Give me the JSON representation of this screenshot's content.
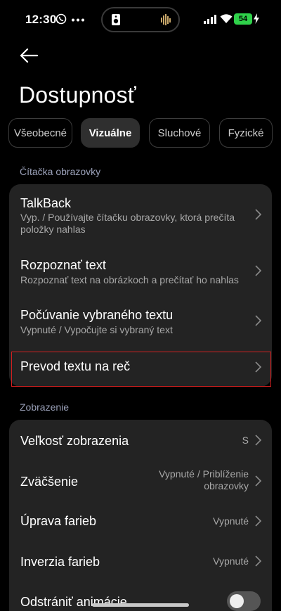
{
  "status": {
    "time": "12:30",
    "battery": "54"
  },
  "header": {
    "title": "Dostupnosť"
  },
  "tabs": [
    {
      "label": "Všeobecné"
    },
    {
      "label": "Vizuálne"
    },
    {
      "label": "Sluchové"
    },
    {
      "label": "Fyzické"
    }
  ],
  "sections": {
    "reader": {
      "label": "Čítačka obrazovky",
      "items": [
        {
          "title": "TalkBack",
          "subtitle": "Vyp. / Používajte čítačku obrazovky, ktorá prečíta položky nahlas"
        },
        {
          "title": "Rozpoznať text",
          "subtitle": "Rozpoznať text na obrázkoch a prečítať ho nahlas"
        },
        {
          "title": "Počúvanie vybraného textu",
          "subtitle": "Vypnuté / Vypočujte si vybraný text"
        },
        {
          "title": "Prevod textu na reč"
        }
      ]
    },
    "display": {
      "label": "Zobrazenie",
      "items": [
        {
          "title": "Veľkosť zobrazenia",
          "value": "S"
        },
        {
          "title": "Zväčšenie",
          "value": "Vypnuté / Priblíženie obrazovky"
        },
        {
          "title": "Úprava farieb",
          "value": "Vypnuté"
        },
        {
          "title": "Inverzia farieb",
          "value": "Vypnuté"
        },
        {
          "title": "Odstrániť animácie",
          "toggle_on": false
        }
      ]
    }
  },
  "colors": {
    "highlight": "#d32020",
    "battery": "#2fd14a",
    "section_label": "#9aa0b8"
  }
}
